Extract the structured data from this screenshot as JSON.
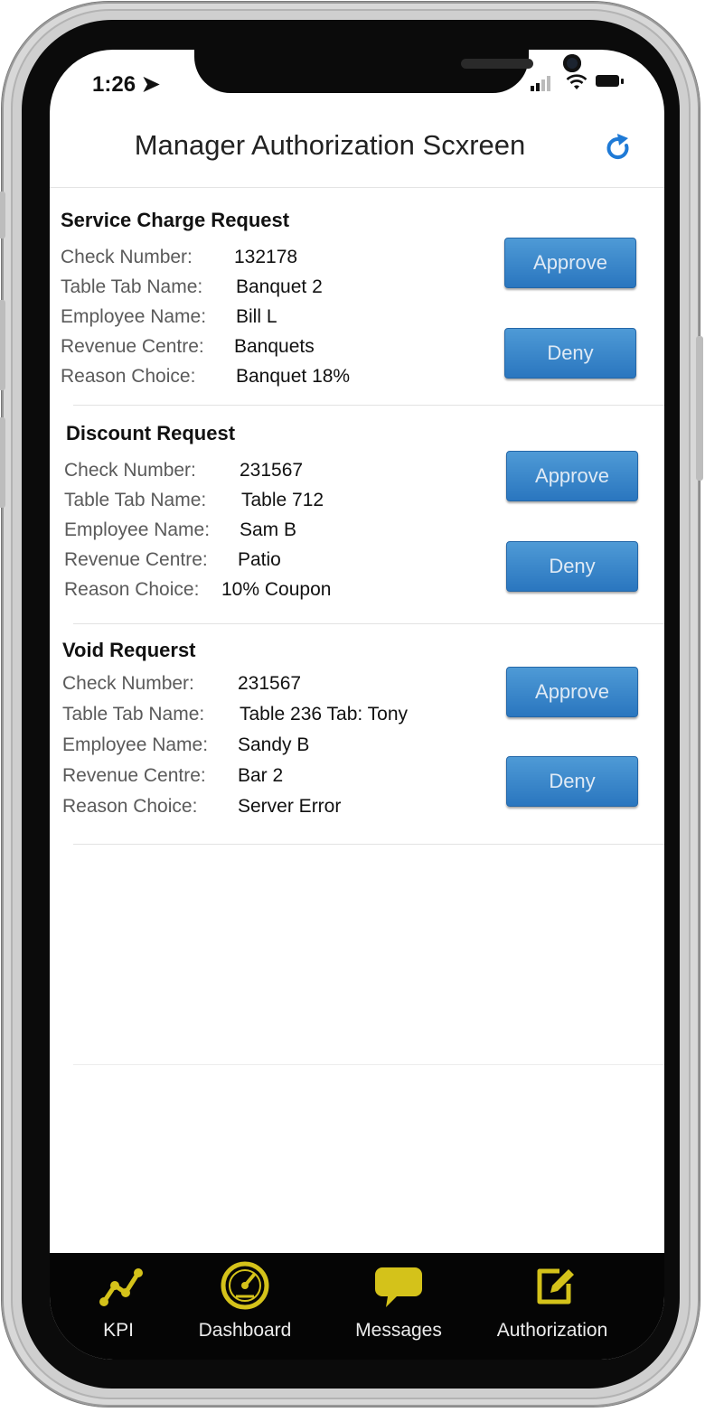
{
  "status_bar": {
    "time": "1:26 ➤"
  },
  "nav": {
    "title": "Manager Authorization Scxreen",
    "refresh_icon": "refresh-icon"
  },
  "requests": [
    {
      "title": "Service Charge Request",
      "fields": [
        {
          "label": "Check Number:",
          "value": "132178"
        },
        {
          "label": "Table Tab Name:",
          "value": "Banquet 2"
        },
        {
          "label": "Employee Name:",
          "value": "Bill L"
        },
        {
          "label": "Revenue Centre:",
          "value": "Banquets"
        },
        {
          "label": "Reason Choice:",
          "value": "Banquet 18%"
        }
      ],
      "approve_label": "Approve",
      "deny_label": "Deny"
    },
    {
      "title": "Discount Request",
      "fields": [
        {
          "label": "Check Number:",
          "value": "231567"
        },
        {
          "label": "Table Tab Name:",
          "value": "Table 712"
        },
        {
          "label": "Employee Name:",
          "value": "Sam B"
        },
        {
          "label": "Revenue Centre:",
          "value": "Patio"
        },
        {
          "label": "Reason Choice:",
          "value": "10% Coupon"
        }
      ],
      "approve_label": "Approve",
      "deny_label": "Deny"
    },
    {
      "title": "Void Requerst",
      "fields": [
        {
          "label": "Check Number:",
          "value": "231567"
        },
        {
          "label": "Table Tab Name:",
          "value": "Table 236 Tab: Tony"
        },
        {
          "label": "Employee Name:",
          "value": "Sandy B"
        },
        {
          "label": "Revenue Centre:",
          "value": "Bar 2"
        },
        {
          "label": "Reason Choice:",
          "value": "Server Error"
        }
      ],
      "approve_label": "Approve",
      "deny_label": "Deny"
    }
  ],
  "tabbar": {
    "items": [
      {
        "label": "KPI",
        "icon": "line-chart-icon"
      },
      {
        "label": "Dashboard",
        "icon": "gauge-icon"
      },
      {
        "label": "Messages",
        "icon": "speech-bubble-icon"
      },
      {
        "label": "Authorization",
        "icon": "edit-icon"
      }
    ]
  },
  "colors": {
    "accent_button": "#2f7fc4",
    "refresh_icon": "#1f7ad6",
    "tab_icon": "#d4c21a",
    "tabbar_bg": "#050505"
  }
}
